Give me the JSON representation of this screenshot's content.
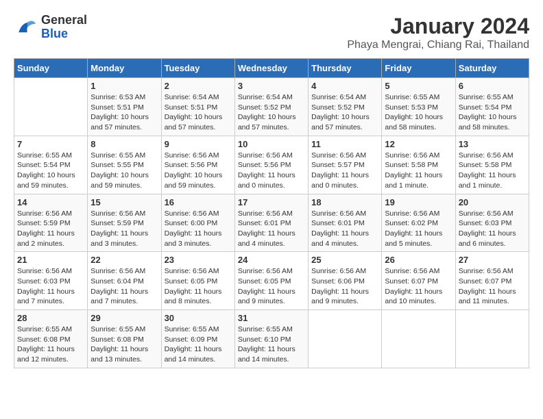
{
  "header": {
    "logo_line1": "General",
    "logo_line2": "Blue",
    "title": "January 2024",
    "subtitle": "Phaya Mengrai, Chiang Rai, Thailand"
  },
  "days_of_week": [
    "Sunday",
    "Monday",
    "Tuesday",
    "Wednesday",
    "Thursday",
    "Friday",
    "Saturday"
  ],
  "weeks": [
    [
      {
        "day": "",
        "info": ""
      },
      {
        "day": "1",
        "info": "Sunrise: 6:53 AM\nSunset: 5:51 PM\nDaylight: 10 hours\nand 57 minutes."
      },
      {
        "day": "2",
        "info": "Sunrise: 6:54 AM\nSunset: 5:51 PM\nDaylight: 10 hours\nand 57 minutes."
      },
      {
        "day": "3",
        "info": "Sunrise: 6:54 AM\nSunset: 5:52 PM\nDaylight: 10 hours\nand 57 minutes."
      },
      {
        "day": "4",
        "info": "Sunrise: 6:54 AM\nSunset: 5:52 PM\nDaylight: 10 hours\nand 57 minutes."
      },
      {
        "day": "5",
        "info": "Sunrise: 6:55 AM\nSunset: 5:53 PM\nDaylight: 10 hours\nand 58 minutes."
      },
      {
        "day": "6",
        "info": "Sunrise: 6:55 AM\nSunset: 5:54 PM\nDaylight: 10 hours\nand 58 minutes."
      }
    ],
    [
      {
        "day": "7",
        "info": "Sunrise: 6:55 AM\nSunset: 5:54 PM\nDaylight: 10 hours\nand 59 minutes."
      },
      {
        "day": "8",
        "info": "Sunrise: 6:55 AM\nSunset: 5:55 PM\nDaylight: 10 hours\nand 59 minutes."
      },
      {
        "day": "9",
        "info": "Sunrise: 6:56 AM\nSunset: 5:56 PM\nDaylight: 10 hours\nand 59 minutes."
      },
      {
        "day": "10",
        "info": "Sunrise: 6:56 AM\nSunset: 5:56 PM\nDaylight: 11 hours\nand 0 minutes."
      },
      {
        "day": "11",
        "info": "Sunrise: 6:56 AM\nSunset: 5:57 PM\nDaylight: 11 hours\nand 0 minutes."
      },
      {
        "day": "12",
        "info": "Sunrise: 6:56 AM\nSunset: 5:58 PM\nDaylight: 11 hours\nand 1 minute."
      },
      {
        "day": "13",
        "info": "Sunrise: 6:56 AM\nSunset: 5:58 PM\nDaylight: 11 hours\nand 1 minute."
      }
    ],
    [
      {
        "day": "14",
        "info": "Sunrise: 6:56 AM\nSunset: 5:59 PM\nDaylight: 11 hours\nand 2 minutes."
      },
      {
        "day": "15",
        "info": "Sunrise: 6:56 AM\nSunset: 5:59 PM\nDaylight: 11 hours\nand 3 minutes."
      },
      {
        "day": "16",
        "info": "Sunrise: 6:56 AM\nSunset: 6:00 PM\nDaylight: 11 hours\nand 3 minutes."
      },
      {
        "day": "17",
        "info": "Sunrise: 6:56 AM\nSunset: 6:01 PM\nDaylight: 11 hours\nand 4 minutes."
      },
      {
        "day": "18",
        "info": "Sunrise: 6:56 AM\nSunset: 6:01 PM\nDaylight: 11 hours\nand 4 minutes."
      },
      {
        "day": "19",
        "info": "Sunrise: 6:56 AM\nSunset: 6:02 PM\nDaylight: 11 hours\nand 5 minutes."
      },
      {
        "day": "20",
        "info": "Sunrise: 6:56 AM\nSunset: 6:03 PM\nDaylight: 11 hours\nand 6 minutes."
      }
    ],
    [
      {
        "day": "21",
        "info": "Sunrise: 6:56 AM\nSunset: 6:03 PM\nDaylight: 11 hours\nand 7 minutes."
      },
      {
        "day": "22",
        "info": "Sunrise: 6:56 AM\nSunset: 6:04 PM\nDaylight: 11 hours\nand 7 minutes."
      },
      {
        "day": "23",
        "info": "Sunrise: 6:56 AM\nSunset: 6:05 PM\nDaylight: 11 hours\nand 8 minutes."
      },
      {
        "day": "24",
        "info": "Sunrise: 6:56 AM\nSunset: 6:05 PM\nDaylight: 11 hours\nand 9 minutes."
      },
      {
        "day": "25",
        "info": "Sunrise: 6:56 AM\nSunset: 6:06 PM\nDaylight: 11 hours\nand 9 minutes."
      },
      {
        "day": "26",
        "info": "Sunrise: 6:56 AM\nSunset: 6:07 PM\nDaylight: 11 hours\nand 10 minutes."
      },
      {
        "day": "27",
        "info": "Sunrise: 6:56 AM\nSunset: 6:07 PM\nDaylight: 11 hours\nand 11 minutes."
      }
    ],
    [
      {
        "day": "28",
        "info": "Sunrise: 6:55 AM\nSunset: 6:08 PM\nDaylight: 11 hours\nand 12 minutes."
      },
      {
        "day": "29",
        "info": "Sunrise: 6:55 AM\nSunset: 6:08 PM\nDaylight: 11 hours\nand 13 minutes."
      },
      {
        "day": "30",
        "info": "Sunrise: 6:55 AM\nSunset: 6:09 PM\nDaylight: 11 hours\nand 14 minutes."
      },
      {
        "day": "31",
        "info": "Sunrise: 6:55 AM\nSunset: 6:10 PM\nDaylight: 11 hours\nand 14 minutes."
      },
      {
        "day": "",
        "info": ""
      },
      {
        "day": "",
        "info": ""
      },
      {
        "day": "",
        "info": ""
      }
    ]
  ]
}
